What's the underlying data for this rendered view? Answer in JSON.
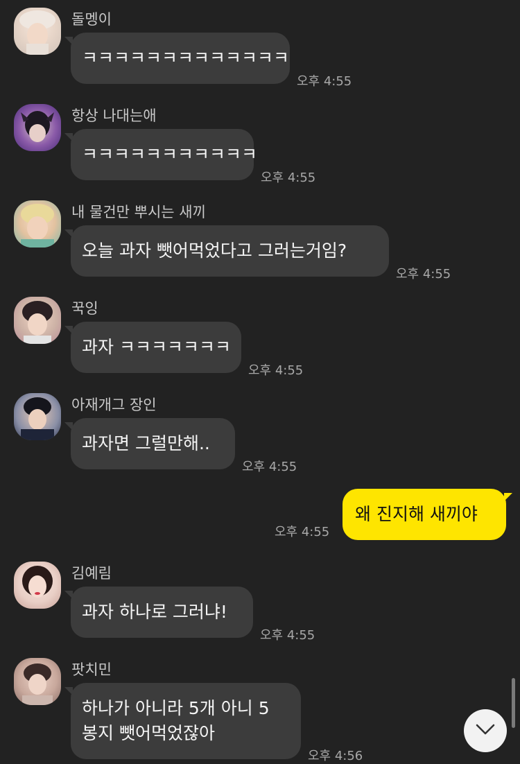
{
  "messages": [
    {
      "sender": "돌멩이",
      "text": "ㅋㅋㅋㅋㅋㅋㅋㅋㅋㅋㅋㅋㅋ",
      "time": "오후 4:55"
    },
    {
      "sender": "항상 나대는애",
      "text": "ㅋㅋㅋㅋㅋㅋㅋㅋㅋㅋㅋ",
      "time": "오후 4:55"
    },
    {
      "sender": "내 물건만 뿌시는 새끼",
      "text": "오늘 과자 뺏어먹었다고 그러는거임?",
      "time": "오후 4:55"
    },
    {
      "sender": "꾹잉",
      "text": "과자 ㅋㅋㅋㅋㅋㅋㅋ",
      "time": "오후 4:55"
    },
    {
      "sender": "아재개그 장인",
      "text": "과자면 그럴만해..",
      "time": "오후 4:55"
    },
    {
      "sender": "김예림",
      "text": "과자 하나로 그러냐!",
      "time": "오후 4:55"
    },
    {
      "sender": "팟치민",
      "text_line1": "하나가 아니라 5개 아니 5",
      "text_line2": "봉지 뺏어먹었잖아",
      "time": "오후 4:56"
    }
  ],
  "my_message": {
    "text": "왜 진지해 새끼야",
    "time": "오후 4:55"
  },
  "colors": {
    "background": "#222222",
    "other_bubble": "#3c3c3c",
    "my_bubble": "#fee500"
  },
  "icons": {
    "scroll_down": "chevron-down-icon"
  }
}
